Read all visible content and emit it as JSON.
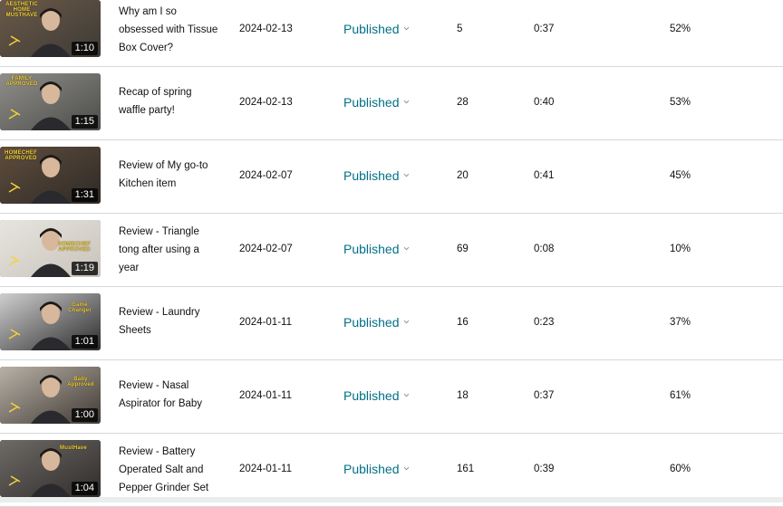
{
  "colors": {
    "link": "#007185",
    "text": "#0f1111",
    "divider": "#d5d9d9",
    "thumb_tag": "#f6d23a"
  },
  "icons": {
    "status_dropdown": "chevron-down-icon"
  },
  "videos": [
    {
      "title": "Why am I so obsessed with Tissue Box Cover?",
      "thumb_tag": "AESTHETIC HOME MUSTHAVE",
      "duration": "1:10",
      "date": "2024-02-13",
      "status": "Published",
      "count": "5",
      "avg_time": "0:37",
      "percent": "52%"
    },
    {
      "title": "Recap of spring waffle party!",
      "thumb_tag": "FAMILY APPROVED",
      "duration": "1:15",
      "date": "2024-02-13",
      "status": "Published",
      "count": "28",
      "avg_time": "0:40",
      "percent": "53%"
    },
    {
      "title": "Review of My go-to Kitchen item",
      "thumb_tag": "HOMECHEF APPROVED",
      "duration": "1:31",
      "date": "2024-02-07",
      "status": "Published",
      "count": "20",
      "avg_time": "0:41",
      "percent": "45%"
    },
    {
      "title": "Review - Triangle tong after using a year",
      "thumb_tag": "HOMECHEF APPROVED",
      "duration": "1:19",
      "date": "2024-02-07",
      "status": "Published",
      "count": "69",
      "avg_time": "0:08",
      "percent": "10%"
    },
    {
      "title": "Review - Laundry Sheets",
      "thumb_tag": "Game Changer",
      "duration": "1:01",
      "date": "2024-01-11",
      "status": "Published",
      "count": "16",
      "avg_time": "0:23",
      "percent": "37%"
    },
    {
      "title": "Review - Nasal Aspirator for Baby",
      "thumb_tag": "Baby Approved",
      "duration": "1:00",
      "date": "2024-01-11",
      "status": "Published",
      "count": "18",
      "avg_time": "0:37",
      "percent": "61%"
    },
    {
      "title": "Review - Battery Operated Salt and Pepper Grinder Set",
      "thumb_tag": "MustHave",
      "duration": "1:04",
      "date": "2024-01-11",
      "status": "Published",
      "count": "161",
      "avg_time": "0:39",
      "percent": "60%"
    }
  ]
}
